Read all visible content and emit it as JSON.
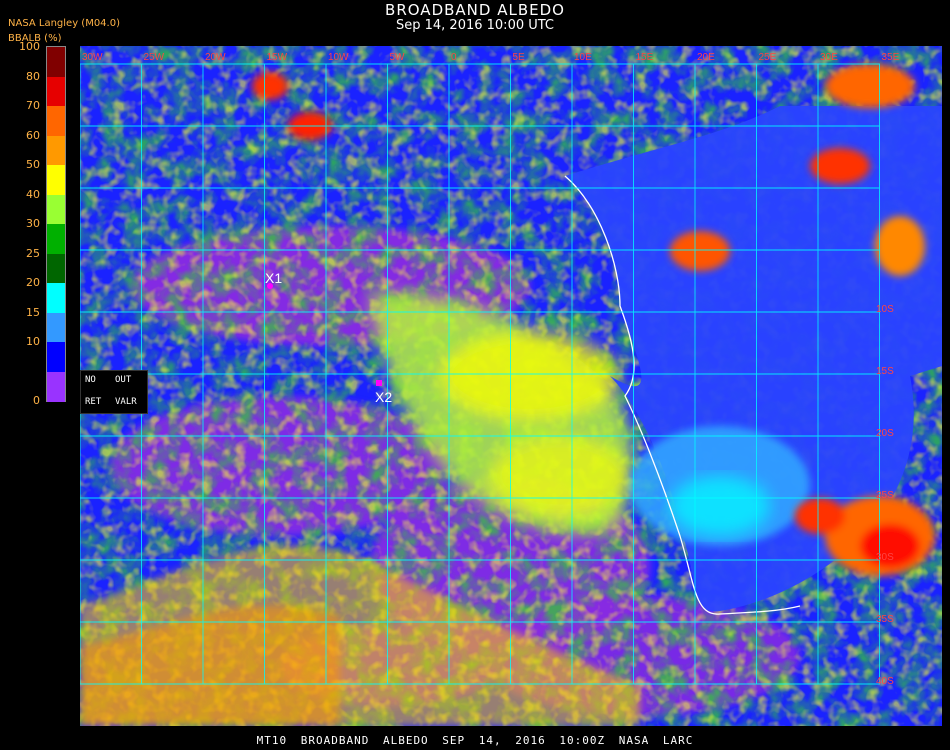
{
  "header": {
    "title": "BROADBAND ALBEDO",
    "subtitle": "Sep 14, 2016 10:00 UTC",
    "source": "NASA Langley (M04.0)",
    "product": "BBALB (%)"
  },
  "colorbar": {
    "ticks": [
      "100",
      "80",
      "70",
      "60",
      "50",
      "40",
      "30",
      "25",
      "20",
      "15",
      "10",
      "0"
    ],
    "colors": [
      "#800000",
      "#e60000",
      "#ff6600",
      "#ff9900",
      "#ffff00",
      "#99ff33",
      "#00b000",
      "#006600",
      "#00ffff",
      "#3399ff",
      "#0000ff",
      "#9933ff"
    ]
  },
  "nodata_legend": {
    "no": "NO",
    "out": "OUT",
    "ret": "RET",
    "valr": "VALR"
  },
  "markers": [
    {
      "label": "X1"
    },
    {
      "label": "X2"
    }
  ],
  "lon_labels": [
    "30W",
    "25W",
    "20W",
    "15W",
    "10W",
    "5W",
    "0",
    "5E",
    "10E",
    "15E",
    "20E",
    "25E",
    "30E",
    "35E"
  ],
  "lat_labels": [
    "10S",
    "15S",
    "20S",
    "25S",
    "30S",
    "35S",
    "40S"
  ],
  "footer": "MT10   BROADBAND ALBEDO   SEP 14, 2016 10:00Z   NASA LARC"
}
